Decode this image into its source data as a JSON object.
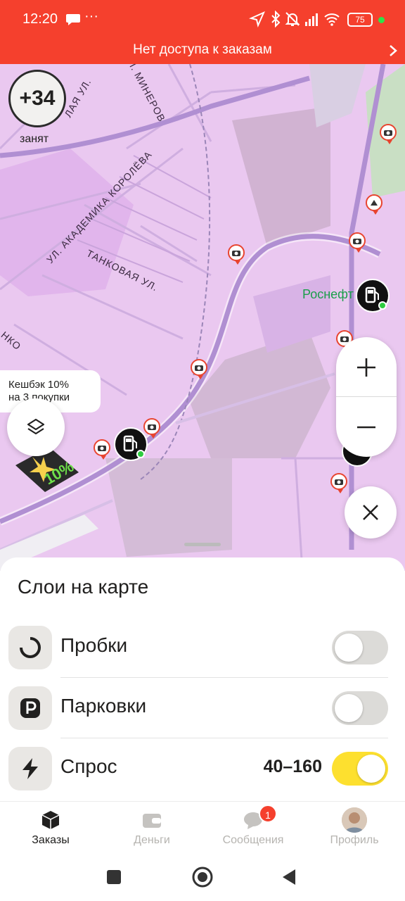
{
  "status_bar": {
    "time": "12:20",
    "more": "···",
    "battery_level": "75"
  },
  "banner": {
    "text": "Нет доступа к заказам"
  },
  "map": {
    "score": "+34",
    "score_label": "занят",
    "cashback": "Кешбэк 10%\nна 3 покупки",
    "cashback_line1": "Кешбэк 10%",
    "cashback_line2": "на 3 покупки",
    "badge_percent": "10%",
    "poi_rosneft": "Роснефт",
    "streets": {
      "s1": "ЛАЯ УЛ.",
      "s2": "Л. МИНЕРОВ",
      "s3": "УЛ. АКАДЕМИКА КОРОЛЁВА",
      "s4": "ТАНКОВАЯ УЛ.",
      "s5": "НКО"
    },
    "zoom_in": "+",
    "zoom_out": "−"
  },
  "sheet": {
    "title": "Слои на карте",
    "layers": [
      {
        "name": "Пробки",
        "value": "",
        "enabled": false,
        "icon": "traffic-icon"
      },
      {
        "name": "Парковки",
        "value": "",
        "enabled": false,
        "icon": "parking-icon"
      },
      {
        "name": "Спрос",
        "value": "40–160",
        "enabled": true,
        "icon": "lightning-icon"
      }
    ]
  },
  "tabs": [
    {
      "label": "Заказы",
      "active": true,
      "icon": "orders-icon"
    },
    {
      "label": "Деньги",
      "active": false,
      "icon": "wallet-icon"
    },
    {
      "label": "Сообщения",
      "active": false,
      "icon": "messages-icon",
      "badge": "1"
    },
    {
      "label": "Профиль",
      "active": false,
      "icon": "avatar"
    }
  ],
  "colors": {
    "brand_red": "#f5402d",
    "toggle_on": "#fde02f",
    "map_bg": "#eac8f0",
    "road": "#b396d6",
    "poi_green": "#1b9e4a"
  }
}
